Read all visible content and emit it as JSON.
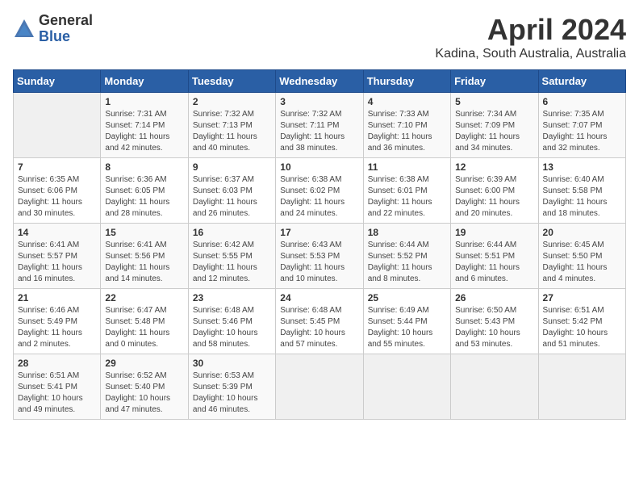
{
  "header": {
    "logo_general": "General",
    "logo_blue": "Blue",
    "month": "April 2024",
    "location": "Kadina, South Australia, Australia"
  },
  "days_of_week": [
    "Sunday",
    "Monday",
    "Tuesday",
    "Wednesday",
    "Thursday",
    "Friday",
    "Saturday"
  ],
  "weeks": [
    [
      {
        "day": "",
        "content": ""
      },
      {
        "day": "1",
        "content": "Sunrise: 7:31 AM\nSunset: 7:14 PM\nDaylight: 11 hours\nand 42 minutes."
      },
      {
        "day": "2",
        "content": "Sunrise: 7:32 AM\nSunset: 7:13 PM\nDaylight: 11 hours\nand 40 minutes."
      },
      {
        "day": "3",
        "content": "Sunrise: 7:32 AM\nSunset: 7:11 PM\nDaylight: 11 hours\nand 38 minutes."
      },
      {
        "day": "4",
        "content": "Sunrise: 7:33 AM\nSunset: 7:10 PM\nDaylight: 11 hours\nand 36 minutes."
      },
      {
        "day": "5",
        "content": "Sunrise: 7:34 AM\nSunset: 7:09 PM\nDaylight: 11 hours\nand 34 minutes."
      },
      {
        "day": "6",
        "content": "Sunrise: 7:35 AM\nSunset: 7:07 PM\nDaylight: 11 hours\nand 32 minutes."
      }
    ],
    [
      {
        "day": "7",
        "content": "Sunrise: 6:35 AM\nSunset: 6:06 PM\nDaylight: 11 hours\nand 30 minutes."
      },
      {
        "day": "8",
        "content": "Sunrise: 6:36 AM\nSunset: 6:05 PM\nDaylight: 11 hours\nand 28 minutes."
      },
      {
        "day": "9",
        "content": "Sunrise: 6:37 AM\nSunset: 6:03 PM\nDaylight: 11 hours\nand 26 minutes."
      },
      {
        "day": "10",
        "content": "Sunrise: 6:38 AM\nSunset: 6:02 PM\nDaylight: 11 hours\nand 24 minutes."
      },
      {
        "day": "11",
        "content": "Sunrise: 6:38 AM\nSunset: 6:01 PM\nDaylight: 11 hours\nand 22 minutes."
      },
      {
        "day": "12",
        "content": "Sunrise: 6:39 AM\nSunset: 6:00 PM\nDaylight: 11 hours\nand 20 minutes."
      },
      {
        "day": "13",
        "content": "Sunrise: 6:40 AM\nSunset: 5:58 PM\nDaylight: 11 hours\nand 18 minutes."
      }
    ],
    [
      {
        "day": "14",
        "content": "Sunrise: 6:41 AM\nSunset: 5:57 PM\nDaylight: 11 hours\nand 16 minutes."
      },
      {
        "day": "15",
        "content": "Sunrise: 6:41 AM\nSunset: 5:56 PM\nDaylight: 11 hours\nand 14 minutes."
      },
      {
        "day": "16",
        "content": "Sunrise: 6:42 AM\nSunset: 5:55 PM\nDaylight: 11 hours\nand 12 minutes."
      },
      {
        "day": "17",
        "content": "Sunrise: 6:43 AM\nSunset: 5:53 PM\nDaylight: 11 hours\nand 10 minutes."
      },
      {
        "day": "18",
        "content": "Sunrise: 6:44 AM\nSunset: 5:52 PM\nDaylight: 11 hours\nand 8 minutes."
      },
      {
        "day": "19",
        "content": "Sunrise: 6:44 AM\nSunset: 5:51 PM\nDaylight: 11 hours\nand 6 minutes."
      },
      {
        "day": "20",
        "content": "Sunrise: 6:45 AM\nSunset: 5:50 PM\nDaylight: 11 hours\nand 4 minutes."
      }
    ],
    [
      {
        "day": "21",
        "content": "Sunrise: 6:46 AM\nSunset: 5:49 PM\nDaylight: 11 hours\nand 2 minutes."
      },
      {
        "day": "22",
        "content": "Sunrise: 6:47 AM\nSunset: 5:48 PM\nDaylight: 11 hours\nand 0 minutes."
      },
      {
        "day": "23",
        "content": "Sunrise: 6:48 AM\nSunset: 5:46 PM\nDaylight: 10 hours\nand 58 minutes."
      },
      {
        "day": "24",
        "content": "Sunrise: 6:48 AM\nSunset: 5:45 PM\nDaylight: 10 hours\nand 57 minutes."
      },
      {
        "day": "25",
        "content": "Sunrise: 6:49 AM\nSunset: 5:44 PM\nDaylight: 10 hours\nand 55 minutes."
      },
      {
        "day": "26",
        "content": "Sunrise: 6:50 AM\nSunset: 5:43 PM\nDaylight: 10 hours\nand 53 minutes."
      },
      {
        "day": "27",
        "content": "Sunrise: 6:51 AM\nSunset: 5:42 PM\nDaylight: 10 hours\nand 51 minutes."
      }
    ],
    [
      {
        "day": "28",
        "content": "Sunrise: 6:51 AM\nSunset: 5:41 PM\nDaylight: 10 hours\nand 49 minutes."
      },
      {
        "day": "29",
        "content": "Sunrise: 6:52 AM\nSunset: 5:40 PM\nDaylight: 10 hours\nand 47 minutes."
      },
      {
        "day": "30",
        "content": "Sunrise: 6:53 AM\nSunset: 5:39 PM\nDaylight: 10 hours\nand 46 minutes."
      },
      {
        "day": "",
        "content": ""
      },
      {
        "day": "",
        "content": ""
      },
      {
        "day": "",
        "content": ""
      },
      {
        "day": "",
        "content": ""
      }
    ]
  ]
}
